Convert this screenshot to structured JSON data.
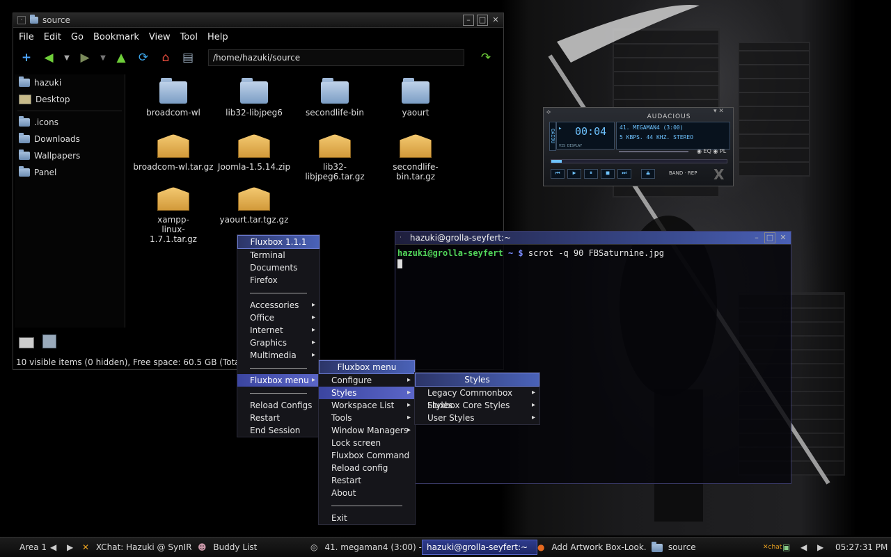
{
  "file_manager": {
    "title": "source",
    "menubar": [
      "File",
      "Edit",
      "Go",
      "Bookmark",
      "View",
      "Tool",
      "Help"
    ],
    "path": "/home/hazuki/source",
    "sidebar": [
      {
        "label": "hazuki",
        "icon": "home-folder-icon"
      },
      {
        "label": "Desktop",
        "icon": "desktop-icon"
      },
      {
        "label": ".icons",
        "icon": "folder-icon"
      },
      {
        "label": "Downloads",
        "icon": "folder-icon"
      },
      {
        "label": "Wallpapers",
        "icon": "folder-icon"
      },
      {
        "label": "Panel",
        "icon": "folder-icon"
      }
    ],
    "files": [
      {
        "name": "broadcom-wl",
        "type": "folder"
      },
      {
        "name": "lib32-libjpeg6",
        "type": "folder"
      },
      {
        "name": "secondlife-bin",
        "type": "folder"
      },
      {
        "name": "yaourt",
        "type": "folder"
      },
      {
        "name": "broadcom-wl.tar.gz",
        "type": "archive"
      },
      {
        "name": "Joomla-1.5.14.zip",
        "type": "archive"
      },
      {
        "name": "lib32-libjpeg6.tar.gz",
        "type": "archive"
      },
      {
        "name": "secondlife-bin.tar.gz",
        "type": "archive"
      },
      {
        "name": "xampp-linux-1.7.1.tar.gz",
        "type": "archive"
      },
      {
        "name": "yaourt.tar.tgz.gz",
        "type": "archive"
      }
    ],
    "status": "10 visible items (0 hidden), Free space: 60.5 GB (Total: 68"
  },
  "audacious": {
    "title": "AUDACIOUS",
    "time": "00:04",
    "track": "41. MEGAMAN4 (3:00)",
    "info": "5 KBPS. 44 KHZ. STEREO",
    "side_label": "OAIDU",
    "vis_label": "VIS DISPLAY",
    "eq_label": "EQ",
    "pl_label": "PL",
    "band_label": "BAND",
    "rep_label": "REP"
  },
  "terminal": {
    "title": "hazuki@grolla-seyfert:~",
    "prompt_user": "hazuki@grolla-seyfert",
    "prompt_path": "~ $",
    "command": "scrot -q 90 FBSaturnine.jpg",
    "colors": {
      "user": "#52d65a",
      "path": "#7a8cff"
    }
  },
  "root_menu": {
    "title": "Fluxbox 1.1.1",
    "items": [
      "Terminal",
      "Documents",
      "Firefox",
      "",
      "Accessories",
      "Office",
      "Internet",
      "Graphics",
      "Multimedia",
      "",
      "Fluxbox menu",
      "",
      "Reload Configs",
      "Restart",
      "End Session"
    ]
  },
  "fluxbox_menu": {
    "title": "Fluxbox menu",
    "items": [
      "Configure",
      "Styles",
      "Workspace List",
      "Tools",
      "Window Managers",
      "Lock screen",
      "Fluxbox Command",
      "Reload config",
      "Restart",
      "About",
      "",
      "Exit"
    ]
  },
  "styles_menu": {
    "title": "Styles",
    "items": [
      "Legacy Commonbox Styles",
      "Fluxbox Core Styles",
      "User Styles"
    ]
  },
  "taskbar": {
    "workspace": "Area 1",
    "tasks": [
      "XChat: Hazuki @ SynIR",
      "Buddy List",
      "41. megaman4 (3:00) -",
      "hazuki@grolla-seyfert:~",
      "Add Artwork Box-Look.",
      "source"
    ],
    "clock": "05:27:31 PM",
    "tray_label": "chat"
  }
}
